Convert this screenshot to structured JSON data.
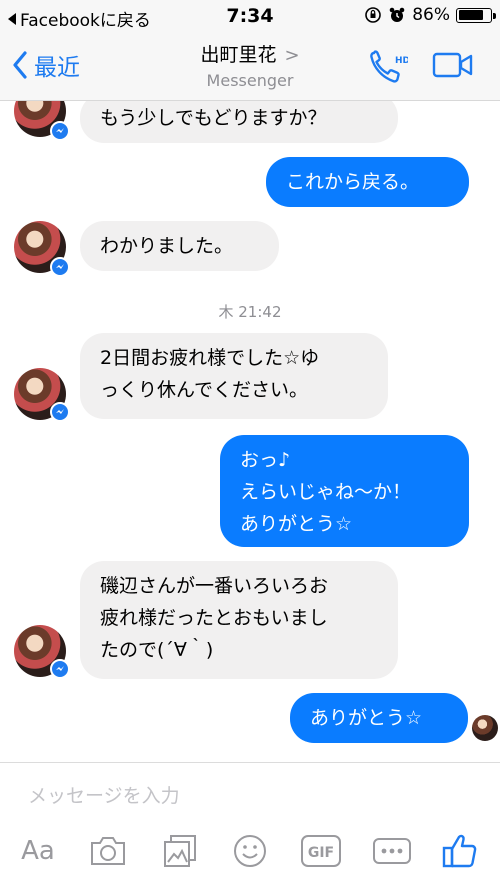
{
  "status_bar": {
    "back_app": "Facebookに戻る",
    "time": "7:34",
    "battery_percent": "86%",
    "battery_level": 0.86
  },
  "nav": {
    "back_label": "最近",
    "contact_name": "出町里花",
    "subtitle": "Messenger",
    "call_icon_text": "HD"
  },
  "messages": [
    {
      "direction": "in",
      "text": "もう少しでもどりますか？"
    },
    {
      "direction": "out",
      "text": "これから戻る。"
    },
    {
      "direction": "in",
      "text": "わかりました。"
    },
    {
      "direction": "timestamp",
      "text": "木 21:42"
    },
    {
      "direction": "in",
      "text": "2日間お疲れ様でした☆ゆ\nっくり休んでください。"
    },
    {
      "direction": "out",
      "text": "おっ♪\nえらいじゃね〜か！\nありがとう☆"
    },
    {
      "direction": "in",
      "text": "磯辺さんが一番いろいろお\n疲れ様だったとおもいまし\nたので(´∀｀)"
    },
    {
      "direction": "out",
      "text": "ありがとう☆"
    }
  ],
  "composer": {
    "placeholder": "メッセージを入力",
    "aa_label": "Aa",
    "gif_label": "GIF"
  },
  "colors": {
    "accent": "#1e7bf0",
    "outgoing_bubble": "#0a7cff",
    "incoming_bubble": "#f1f0f0"
  },
  "icons": [
    "chevron-left-icon",
    "phone-hd-icon",
    "video-camera-icon",
    "messenger-badge-icon",
    "camera-icon",
    "gallery-icon",
    "smiley-icon",
    "gif-icon",
    "more-icon",
    "thumbs-up-icon"
  ]
}
